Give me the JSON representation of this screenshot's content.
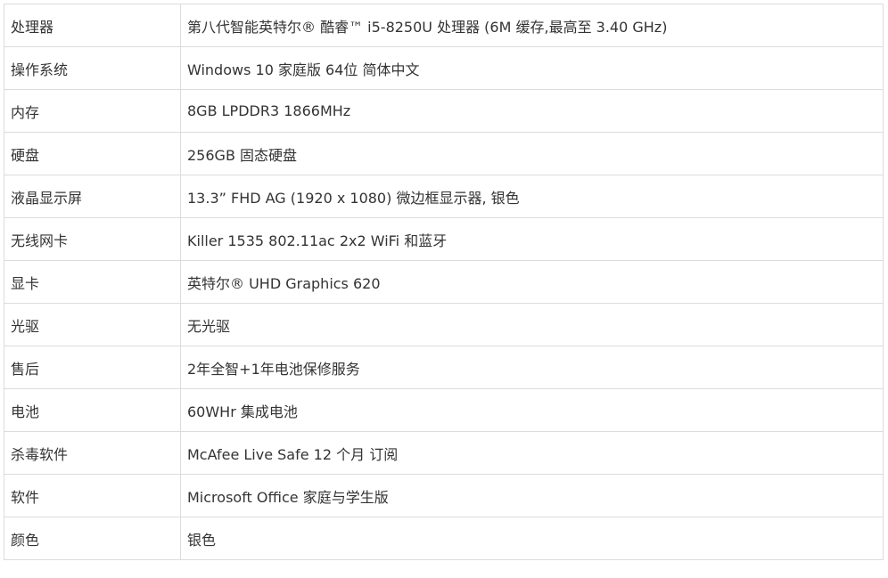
{
  "specs": {
    "rows": [
      {
        "label": "处理器",
        "value": "第八代智能英特尔® 酷睿™ i5-8250U 处理器 (6M 缓存,最高至 3.40 GHz)"
      },
      {
        "label": "操作系统",
        "value": "Windows 10 家庭版 64位 简体中文"
      },
      {
        "label": "内存",
        "value": "8GB LPDDR3 1866MHz"
      },
      {
        "label": "硬盘",
        "value": "256GB 固态硬盘"
      },
      {
        "label": "液晶显示屏",
        "value": "13.3” FHD AG (1920 x 1080) 微边框显示器, 银色"
      },
      {
        "label": "无线网卡",
        "value": "Killer 1535 802.11ac 2x2 WiFi 和蓝牙"
      },
      {
        "label": "显卡",
        "value": "英特尔® UHD Graphics 620"
      },
      {
        "label": "光驱",
        "value": "无光驱"
      },
      {
        "label": "售后",
        "value": "2年全智+1年电池保修服务"
      },
      {
        "label": "电池",
        "value": "60WHr 集成电池"
      },
      {
        "label": "杀毒软件",
        "value": "McAfee Live Safe 12 个月 订阅"
      },
      {
        "label": "软件",
        "value": "Microsoft Office 家庭与学生版"
      },
      {
        "label": "颜色",
        "value": "银色"
      }
    ]
  }
}
